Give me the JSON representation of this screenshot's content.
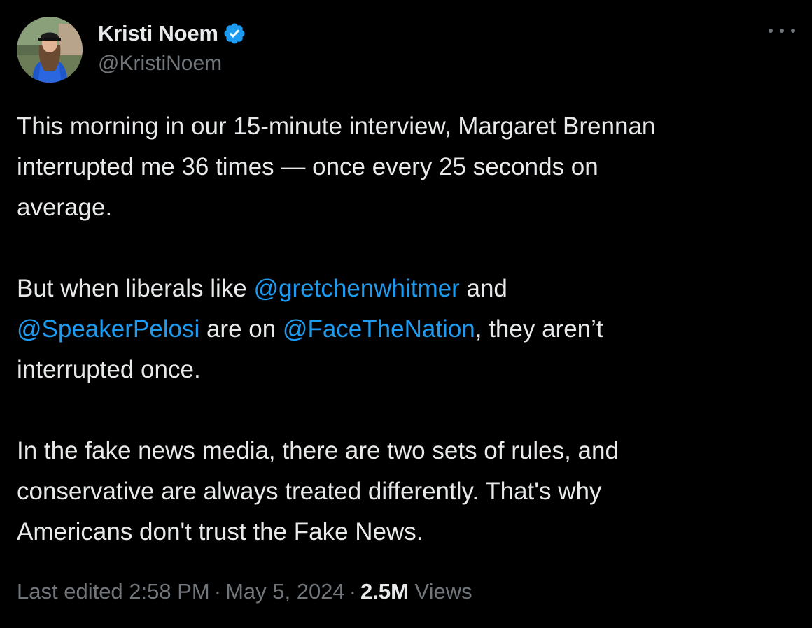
{
  "author": {
    "name": "Kristi Noem",
    "handle": "@KristiNoem",
    "verified_icon": "verified-badge-icon",
    "avatar_icon": "avatar"
  },
  "more_icon": "more-options-icon",
  "body": {
    "p1": {
      "l1": "This morning in our 15-minute interview, Margaret Brennan",
      "l2": "interrupted me 36 times — once every 25 seconds on",
      "l3": "average."
    },
    "p2": {
      "l1_text": "But when liberals like ",
      "mention1": "@gretchenwhitmer",
      "l1_end": " and",
      "mention2": "@SpeakerPelosi",
      "l2_mid": " are on ",
      "mention3": "@FaceTheNation",
      "l2_end": ", they aren’t",
      "l3": "interrupted once."
    },
    "p3": {
      "l1": "In the fake news media, there are two sets of rules, and",
      "l2": "conservative are always treated differently. That's why",
      "l3": "Americans don't trust the Fake News."
    }
  },
  "meta": {
    "edited": "Last edited 2:58 PM",
    "sep": "·",
    "date": "May 5, 2024",
    "views_count": "2.5M",
    "views_label": "Views"
  },
  "colors": {
    "background": "#000000",
    "text": "#e7e9ea",
    "secondary": "#71767b",
    "link": "#1d9bf0",
    "verified": "#1d9bf0"
  }
}
